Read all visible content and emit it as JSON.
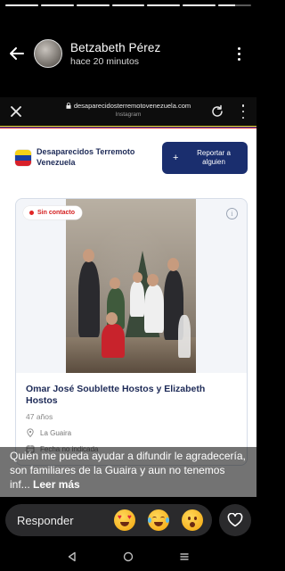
{
  "story": {
    "segments": [
      1,
      1,
      1,
      1,
      1,
      1,
      0.5
    ],
    "user_name": "Betzabeth Pérez",
    "posted_ago": "hace 20 minutos"
  },
  "browser": {
    "url": "desaparecidosterremotovenezuela.com",
    "subtitle": "Instagram"
  },
  "site": {
    "title": "Desaparecidos Terremoto Venezuela",
    "report_button": "Reportar a alguien",
    "flag_colors": [
      "#f7d117",
      "#1a3fa0",
      "#d8202a"
    ]
  },
  "card": {
    "status_badge": "Sin contacto",
    "info_icon": "i",
    "person_name": "Omar José Soublette Hostos y Elizabeth Hostos",
    "age": "47 años",
    "location": "La Guaira",
    "date": "Fecha no indicada"
  },
  "caption": {
    "text": "Quién me pueda ayudar a difundir le agradecería, son familiares de la Guaira y aun no tenemos inf...",
    "more": "Leer más"
  },
  "reply": {
    "placeholder": "Responder",
    "emojis": [
      "heart-eyes-emoji",
      "tears-of-joy-emoji",
      "astonished-emoji"
    ]
  }
}
